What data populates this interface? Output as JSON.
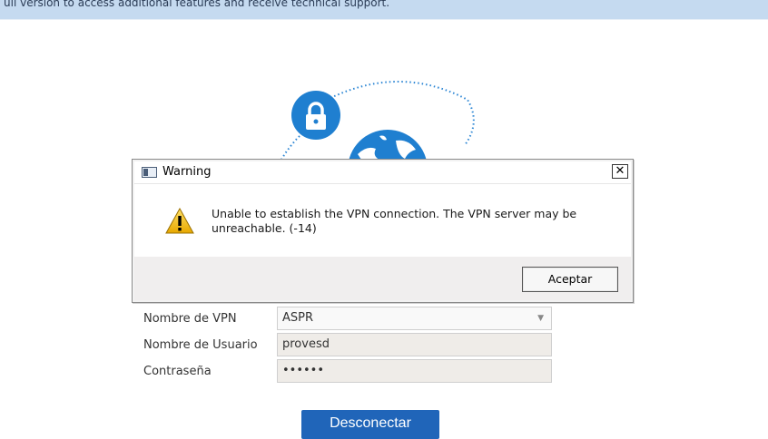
{
  "banner": {
    "text": "ull version to access additional features and receive technical support."
  },
  "dialog": {
    "title": "Warning",
    "close_label": "✕",
    "message": "Unable to establish the VPN connection. The VPN server may be unreachable. (-14)",
    "ok_label": "Aceptar"
  },
  "form": {
    "vpn_name_label": "Nombre de VPN",
    "vpn_name_value": "ASPR",
    "username_label": "Nombre de Usuario",
    "username_value": "provesd",
    "password_label": "Contraseña",
    "password_value": "••••••"
  },
  "actions": {
    "disconnect_label": "Desconectar"
  },
  "colors": {
    "accent": "#2065b9",
    "banner": "#c5daf0",
    "globe": "#1f7fd0",
    "warning": "#f5c518"
  },
  "icons": {
    "lock": "lock-icon",
    "globe": "globe-icon",
    "warning": "warning-icon"
  }
}
